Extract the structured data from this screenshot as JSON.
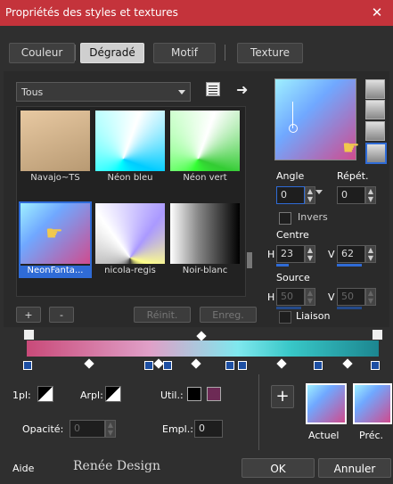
{
  "window": {
    "title": "Propriétés des styles et textures",
    "close_glyph": "✕"
  },
  "tabs": [
    {
      "label": "Couleur"
    },
    {
      "label": "Dégradé",
      "active": true
    },
    {
      "label": "Motif"
    },
    {
      "label": "Texture"
    }
  ],
  "library": {
    "selected": "Tous"
  },
  "gradients": [
    {
      "label": "Navajo~TS"
    },
    {
      "label": "Néon bleu"
    },
    {
      "label": "Néon vert"
    },
    {
      "label": "NeonFanta...",
      "selected": true
    },
    {
      "label": "nicola-regis"
    },
    {
      "label": "Noir-blanc"
    }
  ],
  "actions": {
    "add": "+",
    "remove": "-",
    "reset": "Réinit.",
    "save": "Enreg."
  },
  "settings": {
    "angle_label": "Angle",
    "angle_value": "0",
    "repeat_label": "Répét.",
    "repeat_value": "0",
    "invert_label": "Invers",
    "center_label": "Centre",
    "center_h_label": "H",
    "center_h": "23",
    "center_v_label": "V",
    "center_v": "62",
    "source_label": "Source",
    "source_h_label": "H",
    "source_h": "50",
    "source_v_label": "V",
    "source_v": "50",
    "link_label": "Liaison"
  },
  "lower": {
    "opacity_label": "1pl:",
    "arpl_label": "Arpl:",
    "util_label": "Util.:",
    "opacite_label": "Opacité:",
    "opacite_value": "0",
    "empl_label": "Empl.:",
    "empl_value": "0",
    "current_label": "Actuel",
    "previous_label": "Préc.",
    "add_glyph": "+"
  },
  "footer": {
    "help": "Aide",
    "brand": "Renée Design",
    "ok": "OK",
    "cancel": "Annuler"
  },
  "colors": {
    "accent": "#c4333b",
    "selection": "#2f6bd6",
    "swatch": "#6d2a55"
  }
}
